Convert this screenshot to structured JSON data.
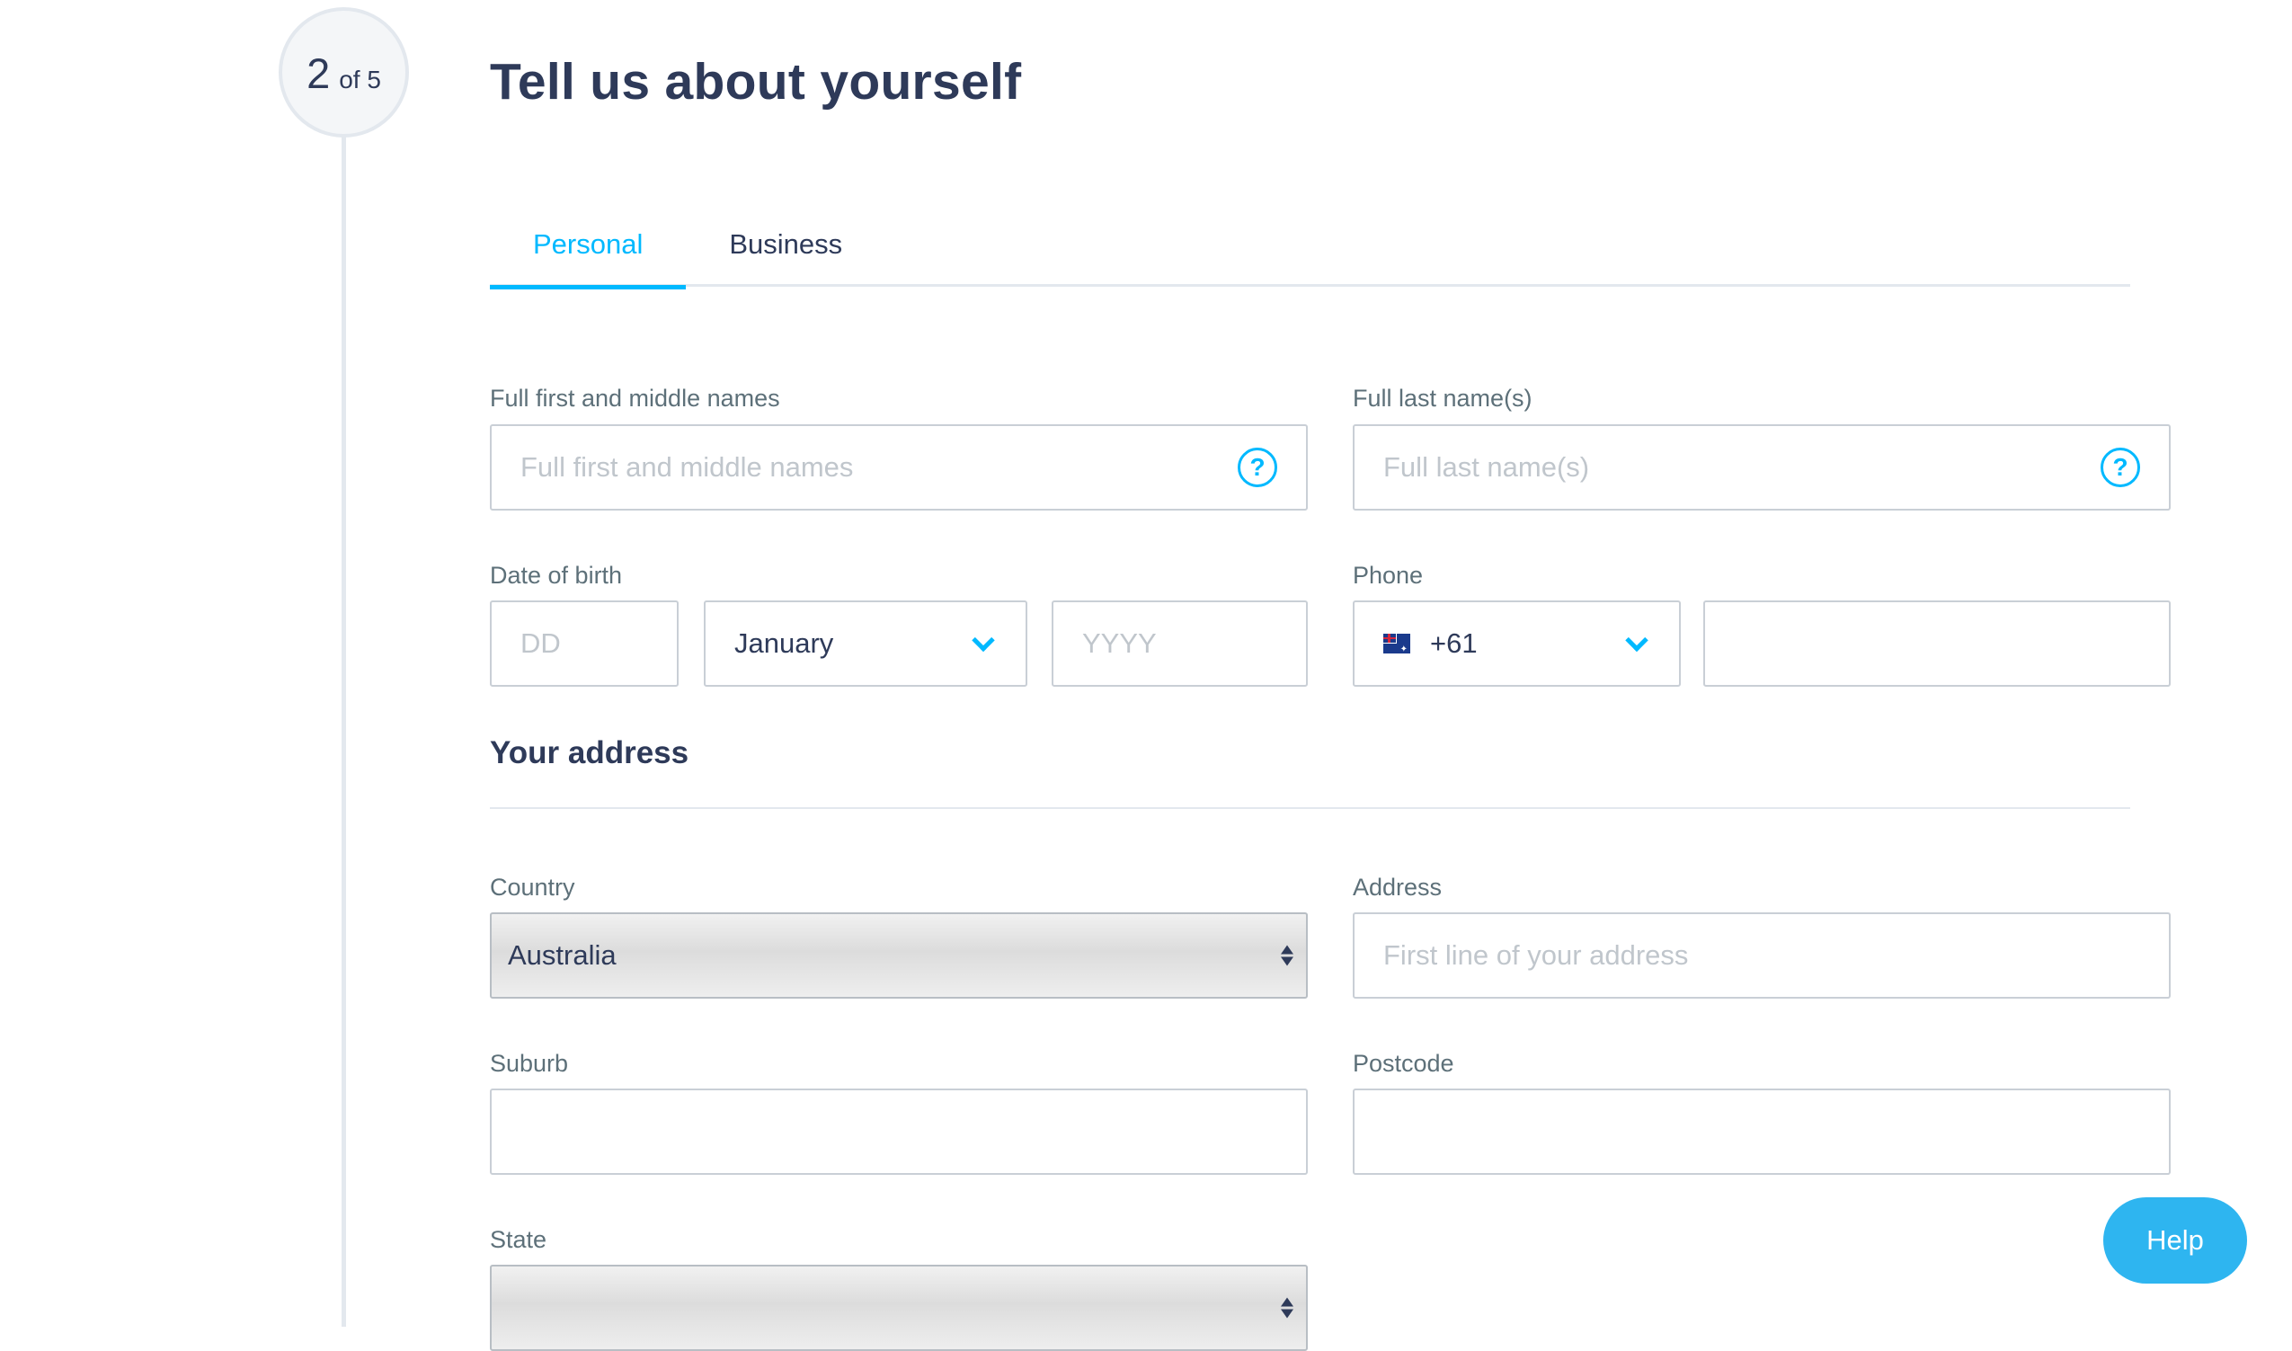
{
  "step": {
    "current": "2",
    "of_label": "of 5"
  },
  "page": {
    "title": "Tell us about yourself"
  },
  "tabs": [
    {
      "label": "Personal",
      "active": true
    },
    {
      "label": "Business",
      "active": false
    }
  ],
  "personal": {
    "first_names": {
      "label": "Full first and middle names",
      "placeholder": "Full first and middle names",
      "value": ""
    },
    "last_names": {
      "label": "Full last name(s)",
      "placeholder": "Full last name(s)",
      "value": ""
    },
    "dob": {
      "label": "Date of birth",
      "day_placeholder": "DD",
      "month_value": "January",
      "year_placeholder": "YYYY"
    },
    "phone": {
      "label": "Phone",
      "country_code": "+61",
      "flag_icon": "australia-flag-icon",
      "value": ""
    }
  },
  "address": {
    "section_title": "Your address",
    "country": {
      "label": "Country",
      "value": "Australia"
    },
    "address_line": {
      "label": "Address",
      "placeholder": "First line of your address"
    },
    "suburb": {
      "label": "Suburb",
      "value": ""
    },
    "postcode": {
      "label": "Postcode",
      "value": ""
    },
    "state": {
      "label": "State",
      "value": ""
    }
  },
  "help_button": {
    "label": "Help"
  },
  "colors": {
    "accent": "#00b9ff",
    "text": "#2e3a59",
    "muted": "#5d7079",
    "border": "#c9cfd6"
  }
}
